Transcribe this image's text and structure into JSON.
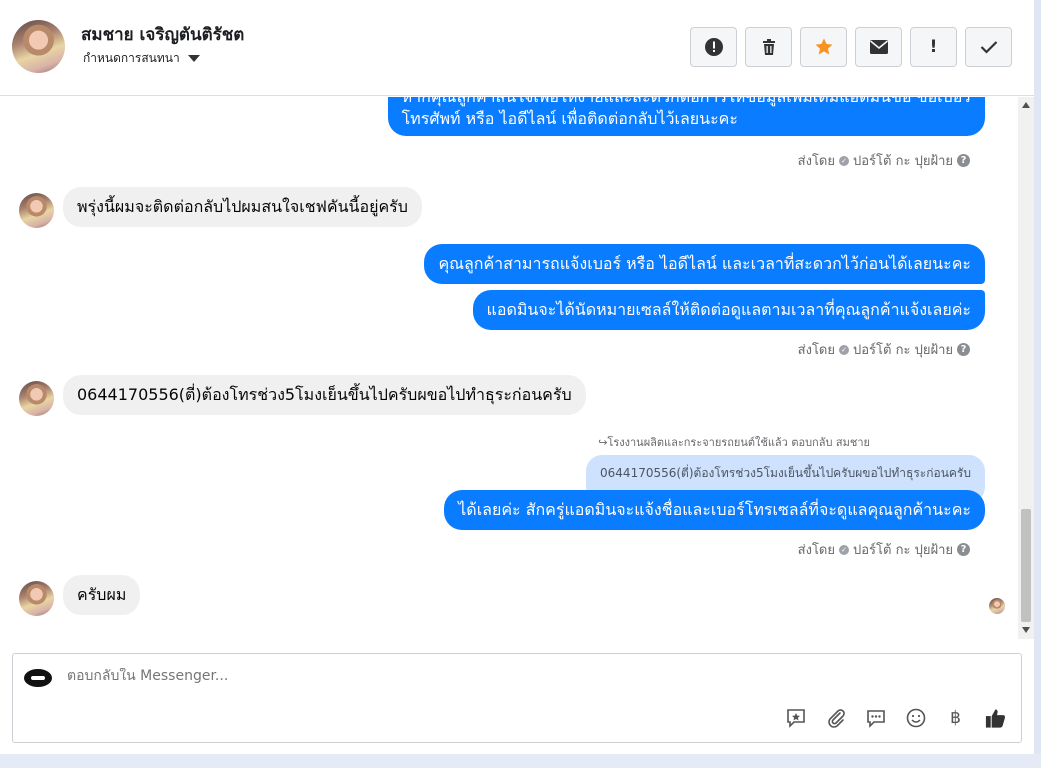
{
  "header": {
    "contact_name": "สมชาย เจริญตันติรัชต",
    "assign_label": "กำหนดการสนทนา",
    "tools": [
      {
        "icon": "alert-circle-icon",
        "name": "spam-button"
      },
      {
        "icon": "trash-icon",
        "name": "delete-button"
      },
      {
        "icon": "star-icon",
        "name": "star-button"
      },
      {
        "icon": "envelope-icon",
        "name": "mark-unread-button"
      },
      {
        "icon": "exclamation-icon",
        "name": "follow-up-button",
        "glyph": "!"
      },
      {
        "icon": "checkmark-icon",
        "name": "done-button",
        "glyph": "✓"
      }
    ]
  },
  "messages": {
    "m1_line1": "หากคุณลูกค้าสนใจเพื่อให้ง่ายและสะดวกต่อการให้ข้อมูลเพิ่มเติมแอดมินขอ ขอเบอร์",
    "m1_line2": "โทรศัพท์ หรือ ไอดีไลน์ เพื่อติดต่อกลับไว้เลยนะคะ",
    "sent_by_1": "ส่งโดย",
    "sender_name_1": "ปอร์โต้ กะ ปุยฝ้าย",
    "in1": "พรุ่งนี้ผมจะติดต่อกลับไปผมสนใจเชฟคันนี้อยู่ครับ",
    "out2": "คุณลูกค้าสามารถแจ้งเบอร์ หรือ ไอดีไลน์ และเวลาที่สะดวกไว้ก่อนได้เลยนะคะ",
    "out3": "แอดมินจะได้นัดหมายเซลล์ให้ติดต่อดูแลตามเวลาที่คุณลูกค้าแจ้งเลยค่ะ",
    "sent_by_2": "ส่งโดย",
    "sender_name_2": "ปอร์โต้ กะ ปุยฝ้าย",
    "in2": "0644170556(ตี่)ต้องโทรช่วง5โมงเย็นขึ้นไปครับผขอไปทำธุระก่อนครับ",
    "reply_context": "↪โรงงานผลิตและกระจายรถยนต์ใช้แล้ว ตอบกลับ สมชาย",
    "quoted": "0644170556(ตี่)ต้องโทรช่วง5โมงเย็นขึ้นไปครับผขอไปทำธุระก่อนครับ",
    "out4": "ได้เลยค่ะ สักครู่แอดมินจะแจ้งชื่อและเบอร์โทรเซลล์ที่จะดูแลคุณลูกค้านะคะ",
    "sent_by_3": "ส่งโดย",
    "sender_name_3": "ปอร์โต้ กะ ปุยฝ้าย",
    "in3": "ครับผม"
  },
  "composer": {
    "placeholder": "ตอบกลับใน Messenger...",
    "tools": [
      "saved-reply-icon",
      "paperclip-icon",
      "chat-bubble-icon",
      "emoji-icon",
      "baht-icon",
      "thumbs-up-icon"
    ],
    "baht_glyph": "฿"
  },
  "colors": {
    "outgoing_bubble": "#0a7cff",
    "incoming_bubble": "#f0f0f0",
    "quoted_bubble": "#cfe2fd",
    "star": "#f7931e"
  }
}
